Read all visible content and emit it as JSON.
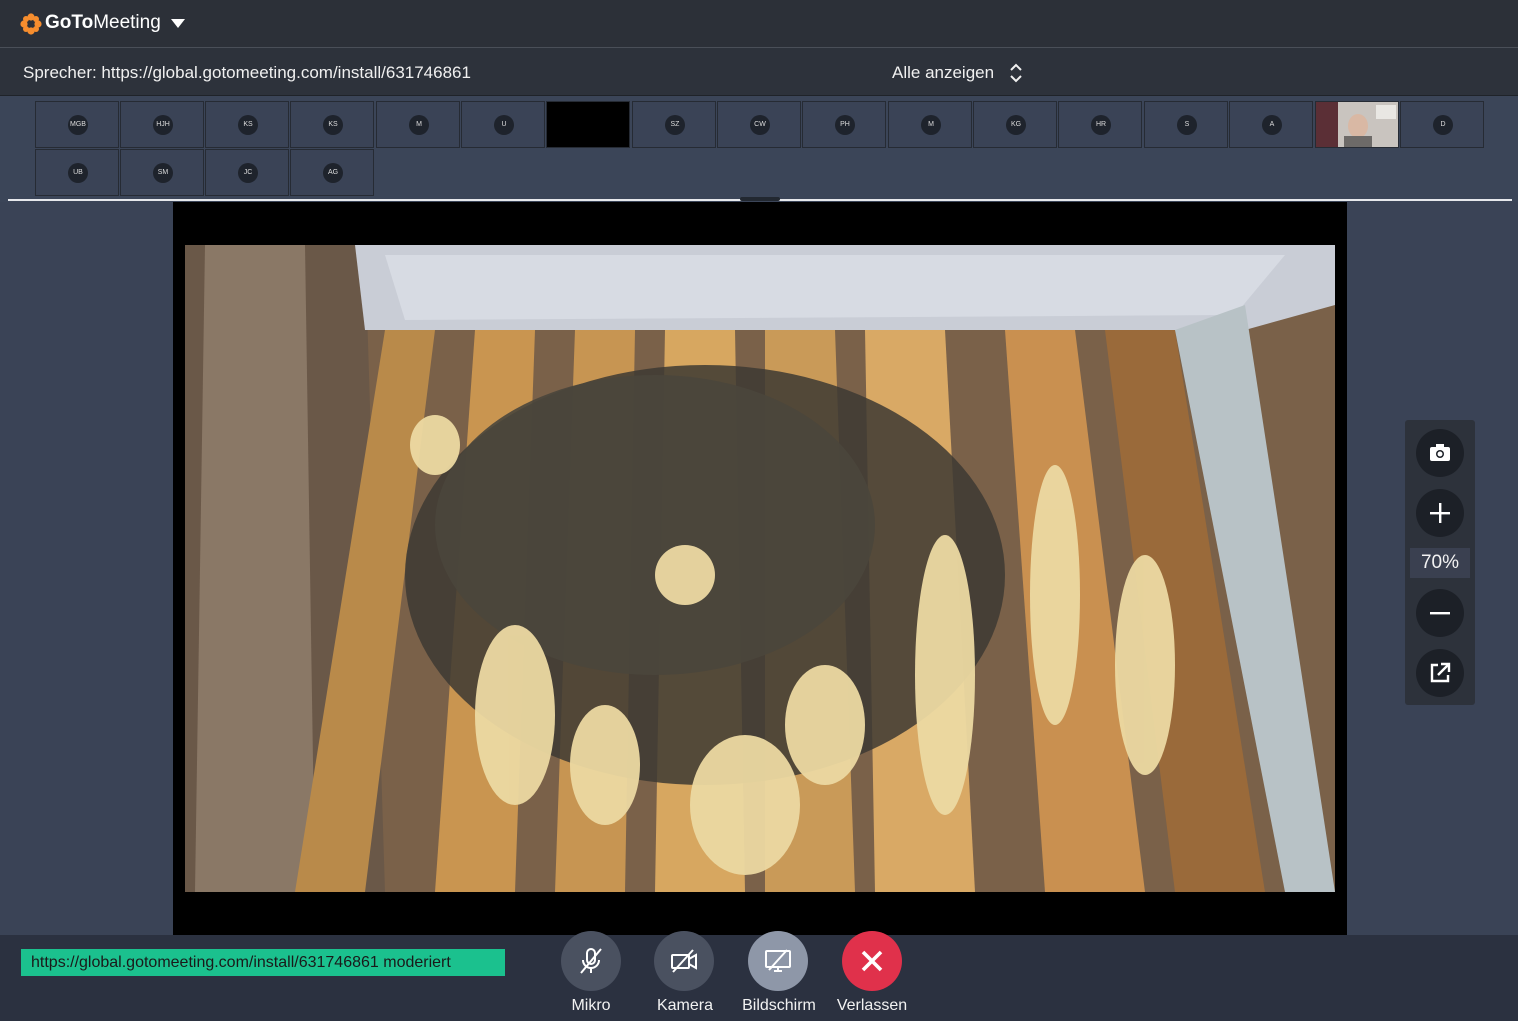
{
  "app": {
    "name_bold": "GoTo",
    "name_rest": "Meeting",
    "brand_color": "#f68d2e"
  },
  "speaker": {
    "text": "Sprecher: https://global.gotomeeting.com/install/631746861",
    "show_all_label": "Alle anzeigen"
  },
  "participants": [
    {
      "initials": "MGB"
    },
    {
      "initials": "HJH"
    },
    {
      "initials": "KS"
    },
    {
      "initials": "KS"
    },
    {
      "initials": "M"
    },
    {
      "initials": "U"
    },
    {
      "initials": ""
    },
    {
      "initials": "SZ"
    },
    {
      "initials": "CW"
    },
    {
      "initials": "PH"
    },
    {
      "initials": "M"
    },
    {
      "initials": "KG"
    },
    {
      "initials": "HR"
    },
    {
      "initials": "S"
    },
    {
      "initials": "A"
    },
    {
      "initials": ""
    },
    {
      "initials": "D"
    },
    {
      "initials": "UB"
    },
    {
      "initials": "SM"
    },
    {
      "initials": "JC"
    },
    {
      "initials": "AG"
    }
  ],
  "zoom": {
    "value": "70%",
    "icons": [
      "camera-icon",
      "plus-icon",
      "minus-icon",
      "popout-icon"
    ]
  },
  "status": {
    "text": "https://global.gotomeeting.com/install/631746861 moderiert",
    "color": "#1bc18e"
  },
  "controls": [
    {
      "label": "Mikro",
      "icon": "mic-muted-icon",
      "color": "#4a5160"
    },
    {
      "label": "Kamera",
      "icon": "camera-off-icon",
      "color": "#4a5160"
    },
    {
      "label": "Bildschirm",
      "icon": "screen-share-icon",
      "color": "#8e97a8"
    },
    {
      "label": "Verlassen",
      "icon": "close-icon",
      "color": "#e0314b"
    }
  ]
}
